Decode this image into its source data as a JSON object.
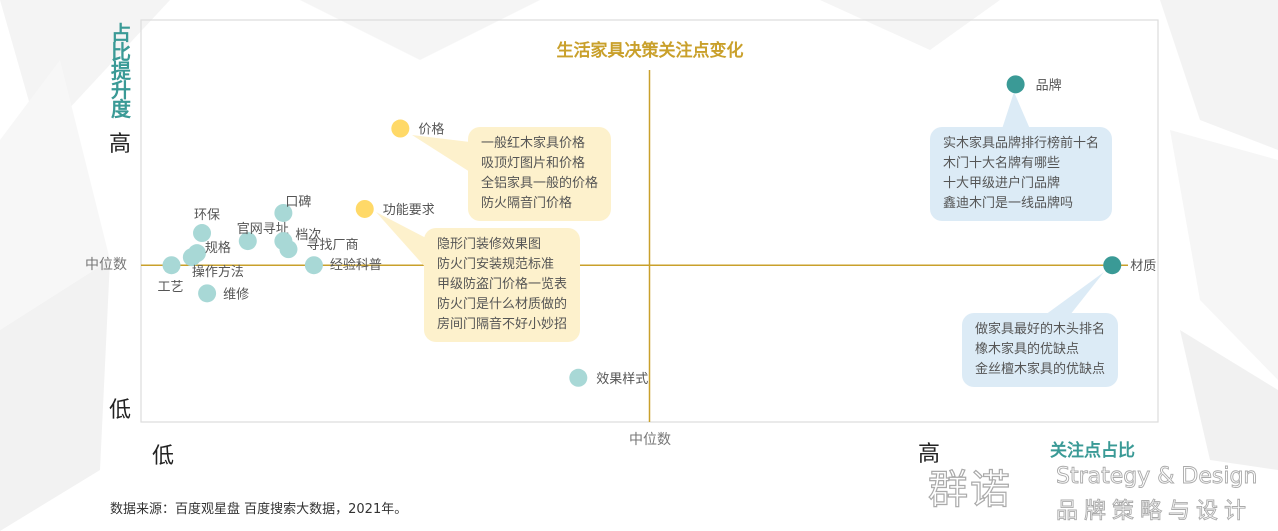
{
  "page": {
    "source_note": "数据来源：百度观星盘  百度搜索大数据，2021年。"
  },
  "logo": {
    "cn": "群诺",
    "en": "Strategy & Design",
    "sub": "品牌策略与设计"
  },
  "labels": {
    "y_axis_title": "占比提升度",
    "y_high": "高",
    "y_low": "低",
    "y_median": "中位数",
    "x_low": "低",
    "x_high": "高",
    "x_median": "中位数",
    "x_axis_title": "关注点占比"
  },
  "colors": {
    "gold": "#c9a02b",
    "teal": "#3a9a96",
    "light_teal": "#a8d8d6",
    "yellow": "#ffd968",
    "callout_yellow": "#fdf1cc",
    "callout_blue": "#dcebf6"
  },
  "chart_data": {
    "type": "scatter",
    "title": "生活家具决策关注点变化",
    "xlabel": "关注点占比",
    "ylabel": "占比提升度",
    "xlim": [
      0,
      100
    ],
    "ylim": [
      0,
      100
    ],
    "x_median": 50,
    "y_median": 39,
    "grid": false,
    "points": [
      {
        "name": "品牌",
        "x": 86,
        "y": 84,
        "group": "high"
      },
      {
        "name": "材质",
        "x": 95.5,
        "y": 39,
        "group": "high"
      },
      {
        "name": "价格",
        "x": 25.5,
        "y": 73,
        "group": "yellow"
      },
      {
        "name": "功能要求",
        "x": 22,
        "y": 53,
        "group": "yellow"
      },
      {
        "name": "口碑",
        "x": 14,
        "y": 52,
        "group": "low"
      },
      {
        "name": "环保",
        "x": 6,
        "y": 47,
        "group": "low"
      },
      {
        "name": "官网寻址",
        "x": 10.5,
        "y": 45,
        "group": "low"
      },
      {
        "name": "档次",
        "x": 14,
        "y": 45,
        "group": "low"
      },
      {
        "name": "寻找厂商",
        "x": 14.5,
        "y": 43,
        "group": "low"
      },
      {
        "name": "规格",
        "x": 5.5,
        "y": 42,
        "group": "low"
      },
      {
        "name": "操作方法",
        "x": 5,
        "y": 41,
        "group": "low"
      },
      {
        "name": "工艺",
        "x": 3,
        "y": 39,
        "group": "low"
      },
      {
        "name": "经验科普",
        "x": 17,
        "y": 39,
        "group": "low"
      },
      {
        "name": "维修",
        "x": 6.5,
        "y": 32,
        "group": "low"
      },
      {
        "name": "效果样式",
        "x": 43,
        "y": 11,
        "group": "low"
      }
    ],
    "annotations": [
      {
        "attached_to": "价格",
        "lines": [
          "一般红木家具价格",
          "吸顶灯图片和价格",
          "全铝家具一般的价格",
          "防火隔音门价格"
        ]
      },
      {
        "attached_to": "功能要求",
        "lines": [
          "隐形门装修效果图",
          "防火门安装规范标准",
          "甲级防盗门价格一览表",
          "防火门是什么材质做的",
          "房间门隔音不好小妙招"
        ]
      },
      {
        "attached_to": "品牌",
        "lines": [
          "实木家具品牌排行榜前十名",
          "木门十大名牌有哪些",
          "十大甲级进户门品牌",
          "鑫迪木门是一线品牌吗"
        ]
      },
      {
        "attached_to": "材质",
        "lines": [
          "做家具最好的木头排名",
          "橡木家具的优缺点",
          "金丝檀木家具的优缺点"
        ]
      }
    ]
  }
}
